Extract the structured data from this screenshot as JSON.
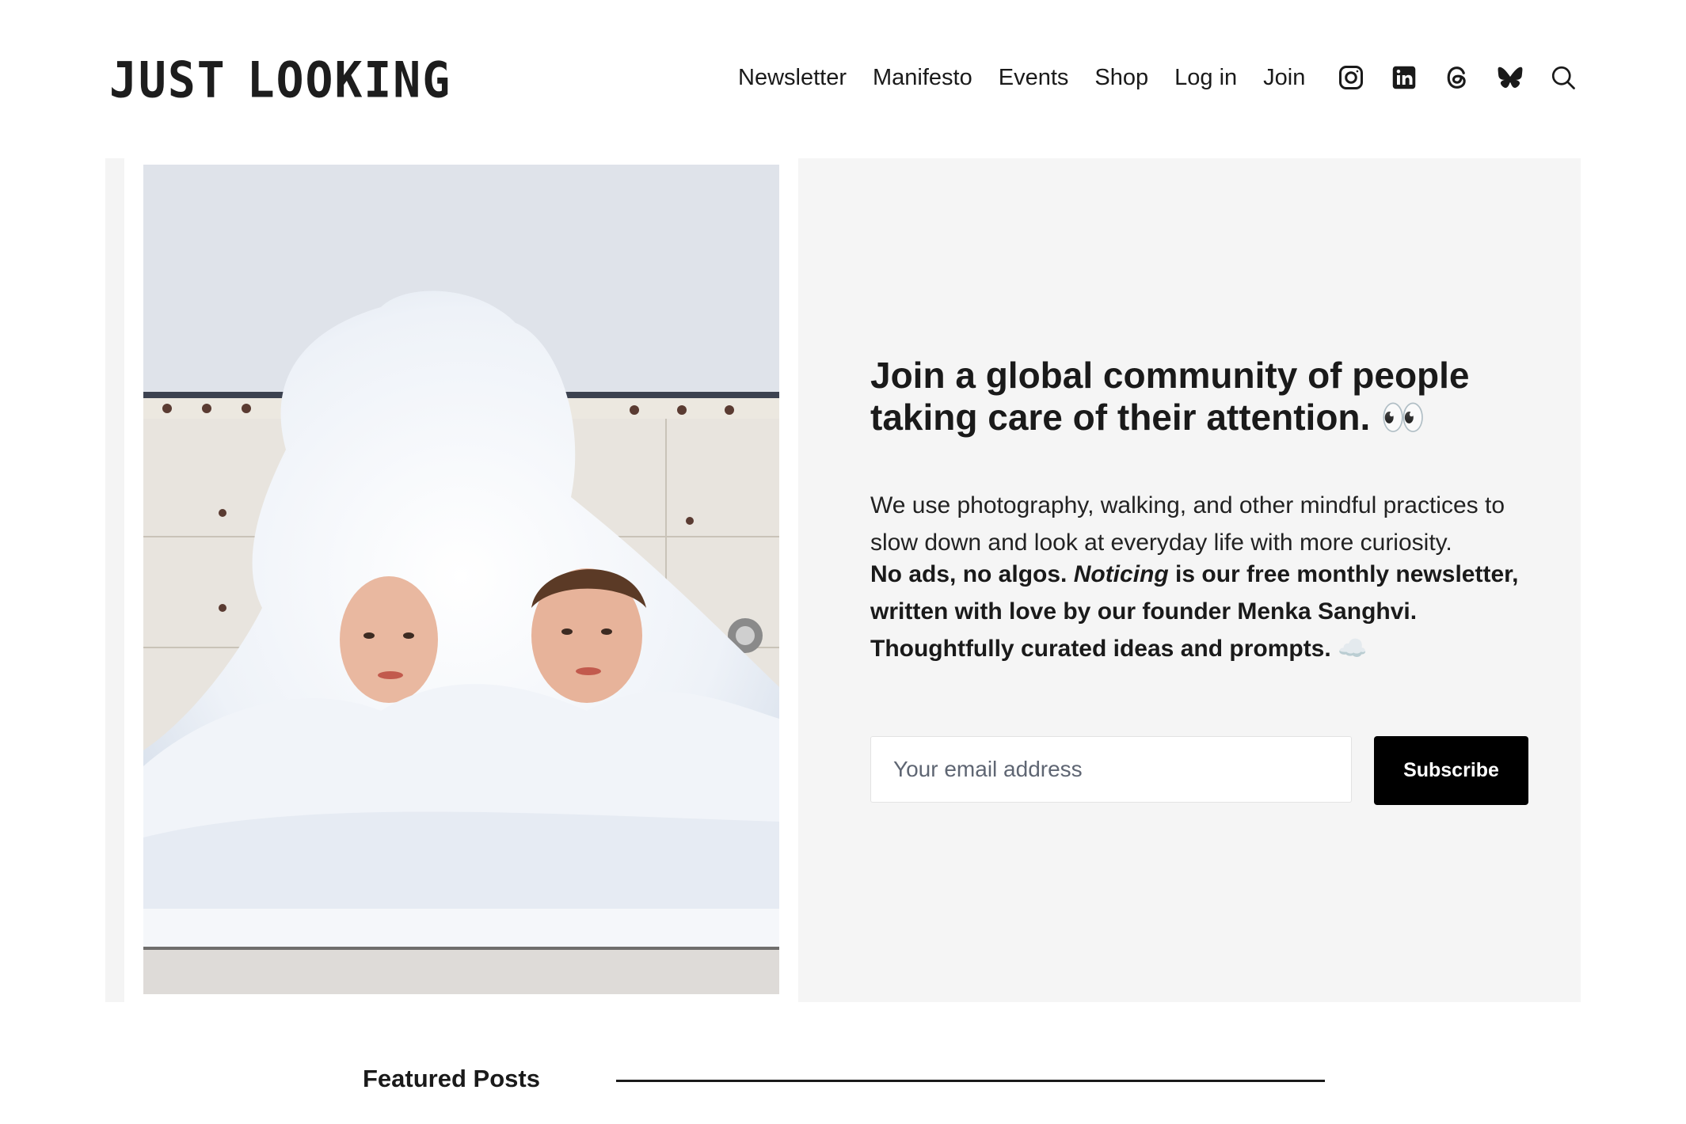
{
  "header": {
    "logo_word1": "JUST",
    "logo_word2": "LOOKING",
    "nav": [
      "Newsletter",
      "Manifesto",
      "Events",
      "Shop",
      "Log in",
      "Join"
    ],
    "icons": [
      "instagram-icon",
      "linkedin-icon",
      "threads-icon",
      "bluesky-icon",
      "search-icon"
    ]
  },
  "hero": {
    "headline": "Join a global community of people taking care of their attention. 👀",
    "description": "We use photography, walking, and other mindful practices to slow down and look at everyday life with more curiosity.",
    "pitch_part1": "No ads, no algos. ",
    "pitch_em": "Noticing",
    "pitch_part2": " is our free monthly newsletter, written with love by our founder Menka Sanghvi. Thoughtfully curated ideas and prompts. ☁️",
    "email_placeholder": "Your email address",
    "subscribe_label": "Subscribe"
  },
  "featured": {
    "title": "Featured Posts"
  },
  "colors": {
    "panel_bg": "#f5f5f5",
    "button_bg": "#000000",
    "text": "#1a1a1a"
  }
}
